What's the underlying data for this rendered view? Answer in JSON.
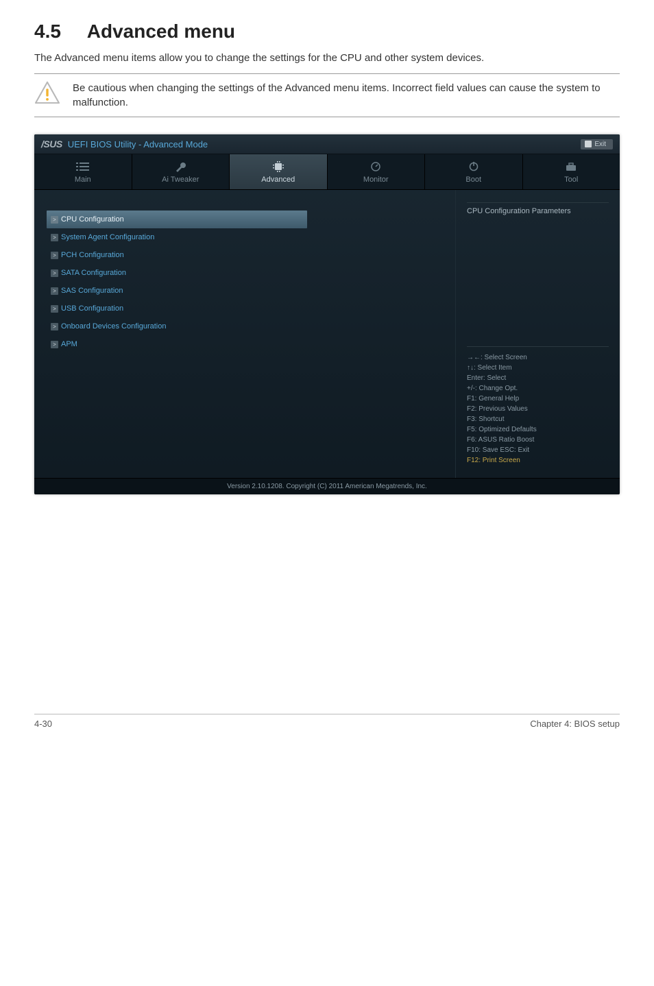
{
  "section": {
    "number": "4.5",
    "title": "Advanced menu",
    "intro": "The Advanced menu items allow you to change the settings for the CPU and other system devices.",
    "caution": "Be cautious when changing the settings of the Advanced menu items. Incorrect field values can cause the system to malfunction."
  },
  "bios": {
    "logo_brand": "/SUS",
    "title": "UEFI BIOS Utility - Advanced Mode",
    "exit_label": "Exit",
    "tabs": [
      {
        "label": "Main"
      },
      {
        "label": "Ai Tweaker"
      },
      {
        "label": "Advanced"
      },
      {
        "label": "Monitor"
      },
      {
        "label": "Boot"
      },
      {
        "label": "Tool"
      }
    ],
    "sidebar_header": "CPU Configuration Parameters",
    "config_items": [
      {
        "label": "CPU Configuration",
        "selected": true
      },
      {
        "label": "System Agent Configuration"
      },
      {
        "label": "PCH Configuration"
      },
      {
        "label": "SATA Configuration"
      },
      {
        "label": "SAS Configuration"
      },
      {
        "label": "USB Configuration"
      },
      {
        "label": "Onboard Devices Configuration"
      },
      {
        "label": "APM"
      }
    ],
    "help": [
      "→←: Select Screen",
      "↑↓: Select Item",
      "Enter: Select",
      "+/-: Change Opt.",
      "F1: General Help",
      "F2: Previous Values",
      "F3: Shortcut",
      "F5: Optimized Defaults",
      "F6: ASUS Ratio Boost",
      "F10: Save   ESC: Exit",
      "F12: Print Screen"
    ],
    "footer": "Version 2.10.1208.  Copyright (C) 2011 American Megatrends, Inc."
  },
  "page_footer": {
    "left": "4-30",
    "right": "Chapter 4: BIOS setup"
  }
}
